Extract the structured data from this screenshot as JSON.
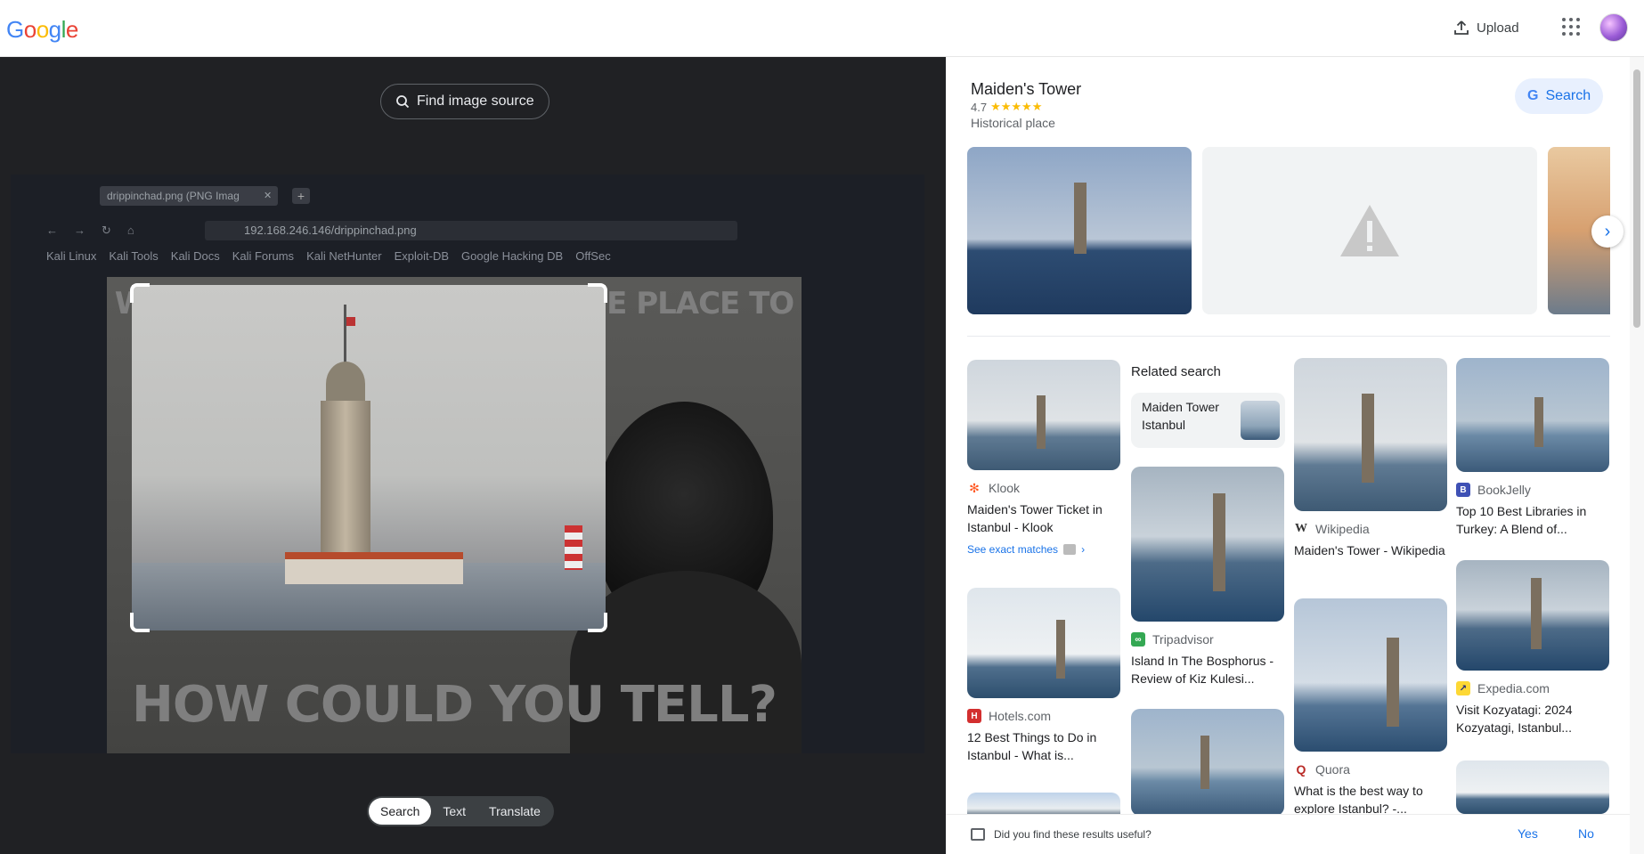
{
  "header": {
    "logo_text": "Google",
    "upload_label": "Upload"
  },
  "left_panel": {
    "find_source_label": "Find image source",
    "screenshot": {
      "tab_title": "drippinchad.png (PNG Imag",
      "url": "192.168.246.146/drippinchad.png",
      "bookmarks": [
        "Kali Linux",
        "Kali Tools",
        "Kali Docs",
        "Kali Forums",
        "Kali NetHunter",
        "Exploit-DB",
        "Google Hacking DB",
        "OffSec"
      ],
      "meme_top": "WHY YES, THIS IS MY FAVORITE PLACE TO RELAX",
      "meme_bottom": "HOW COULD YOU TELL?"
    },
    "modes": [
      "Search",
      "Text",
      "Translate"
    ],
    "active_mode": "Search"
  },
  "knowledge_panel": {
    "title": "Maiden's Tower",
    "rating": "4.7",
    "stars": "★★★★★",
    "category": "Historical place",
    "search_label": "Search"
  },
  "related": {
    "heading": "Related search",
    "chip_label": "Maiden Tower Istanbul"
  },
  "results": [
    {
      "source": "Klook",
      "title": "Maiden's Tower Ticket in Istanbul - Klook",
      "fav_color": "#ff5722",
      "fav_letter": "✻"
    },
    {
      "source": "Hotels.com",
      "title": "12 Best Things to Do in Istanbul - What is...",
      "fav_color": "#d32f2f",
      "fav_letter": "H"
    },
    {
      "source": "Tripadvisor",
      "title": "Island In The Bosphorus - Review of Kiz Kulesi...",
      "fav_color": "#34a853",
      "fav_letter": "∞"
    },
    {
      "source": "Wikipedia",
      "title": "Maiden's Tower - Wikipedia",
      "fav_color": "#ffffff",
      "fav_letter": "W"
    },
    {
      "source": "Quora",
      "title": "What is the best way to explore Istanbul? -...",
      "fav_color": "#b92b27",
      "fav_letter": "Q"
    },
    {
      "source": "BookJelly",
      "title": "Top 10 Best Libraries in Turkey: A Blend of...",
      "fav_color": "#3f51b5",
      "fav_letter": "B"
    },
    {
      "source": "Expedia.com",
      "title": "Visit Kozyatagi: 2024 Kozyatagi, Istanbul...",
      "fav_color": "#fdd835",
      "fav_letter": "↗"
    }
  ],
  "see_exact_matches": "See exact matches",
  "feedback": {
    "question": "Did you find these results useful?",
    "yes": "Yes",
    "no": "No"
  }
}
